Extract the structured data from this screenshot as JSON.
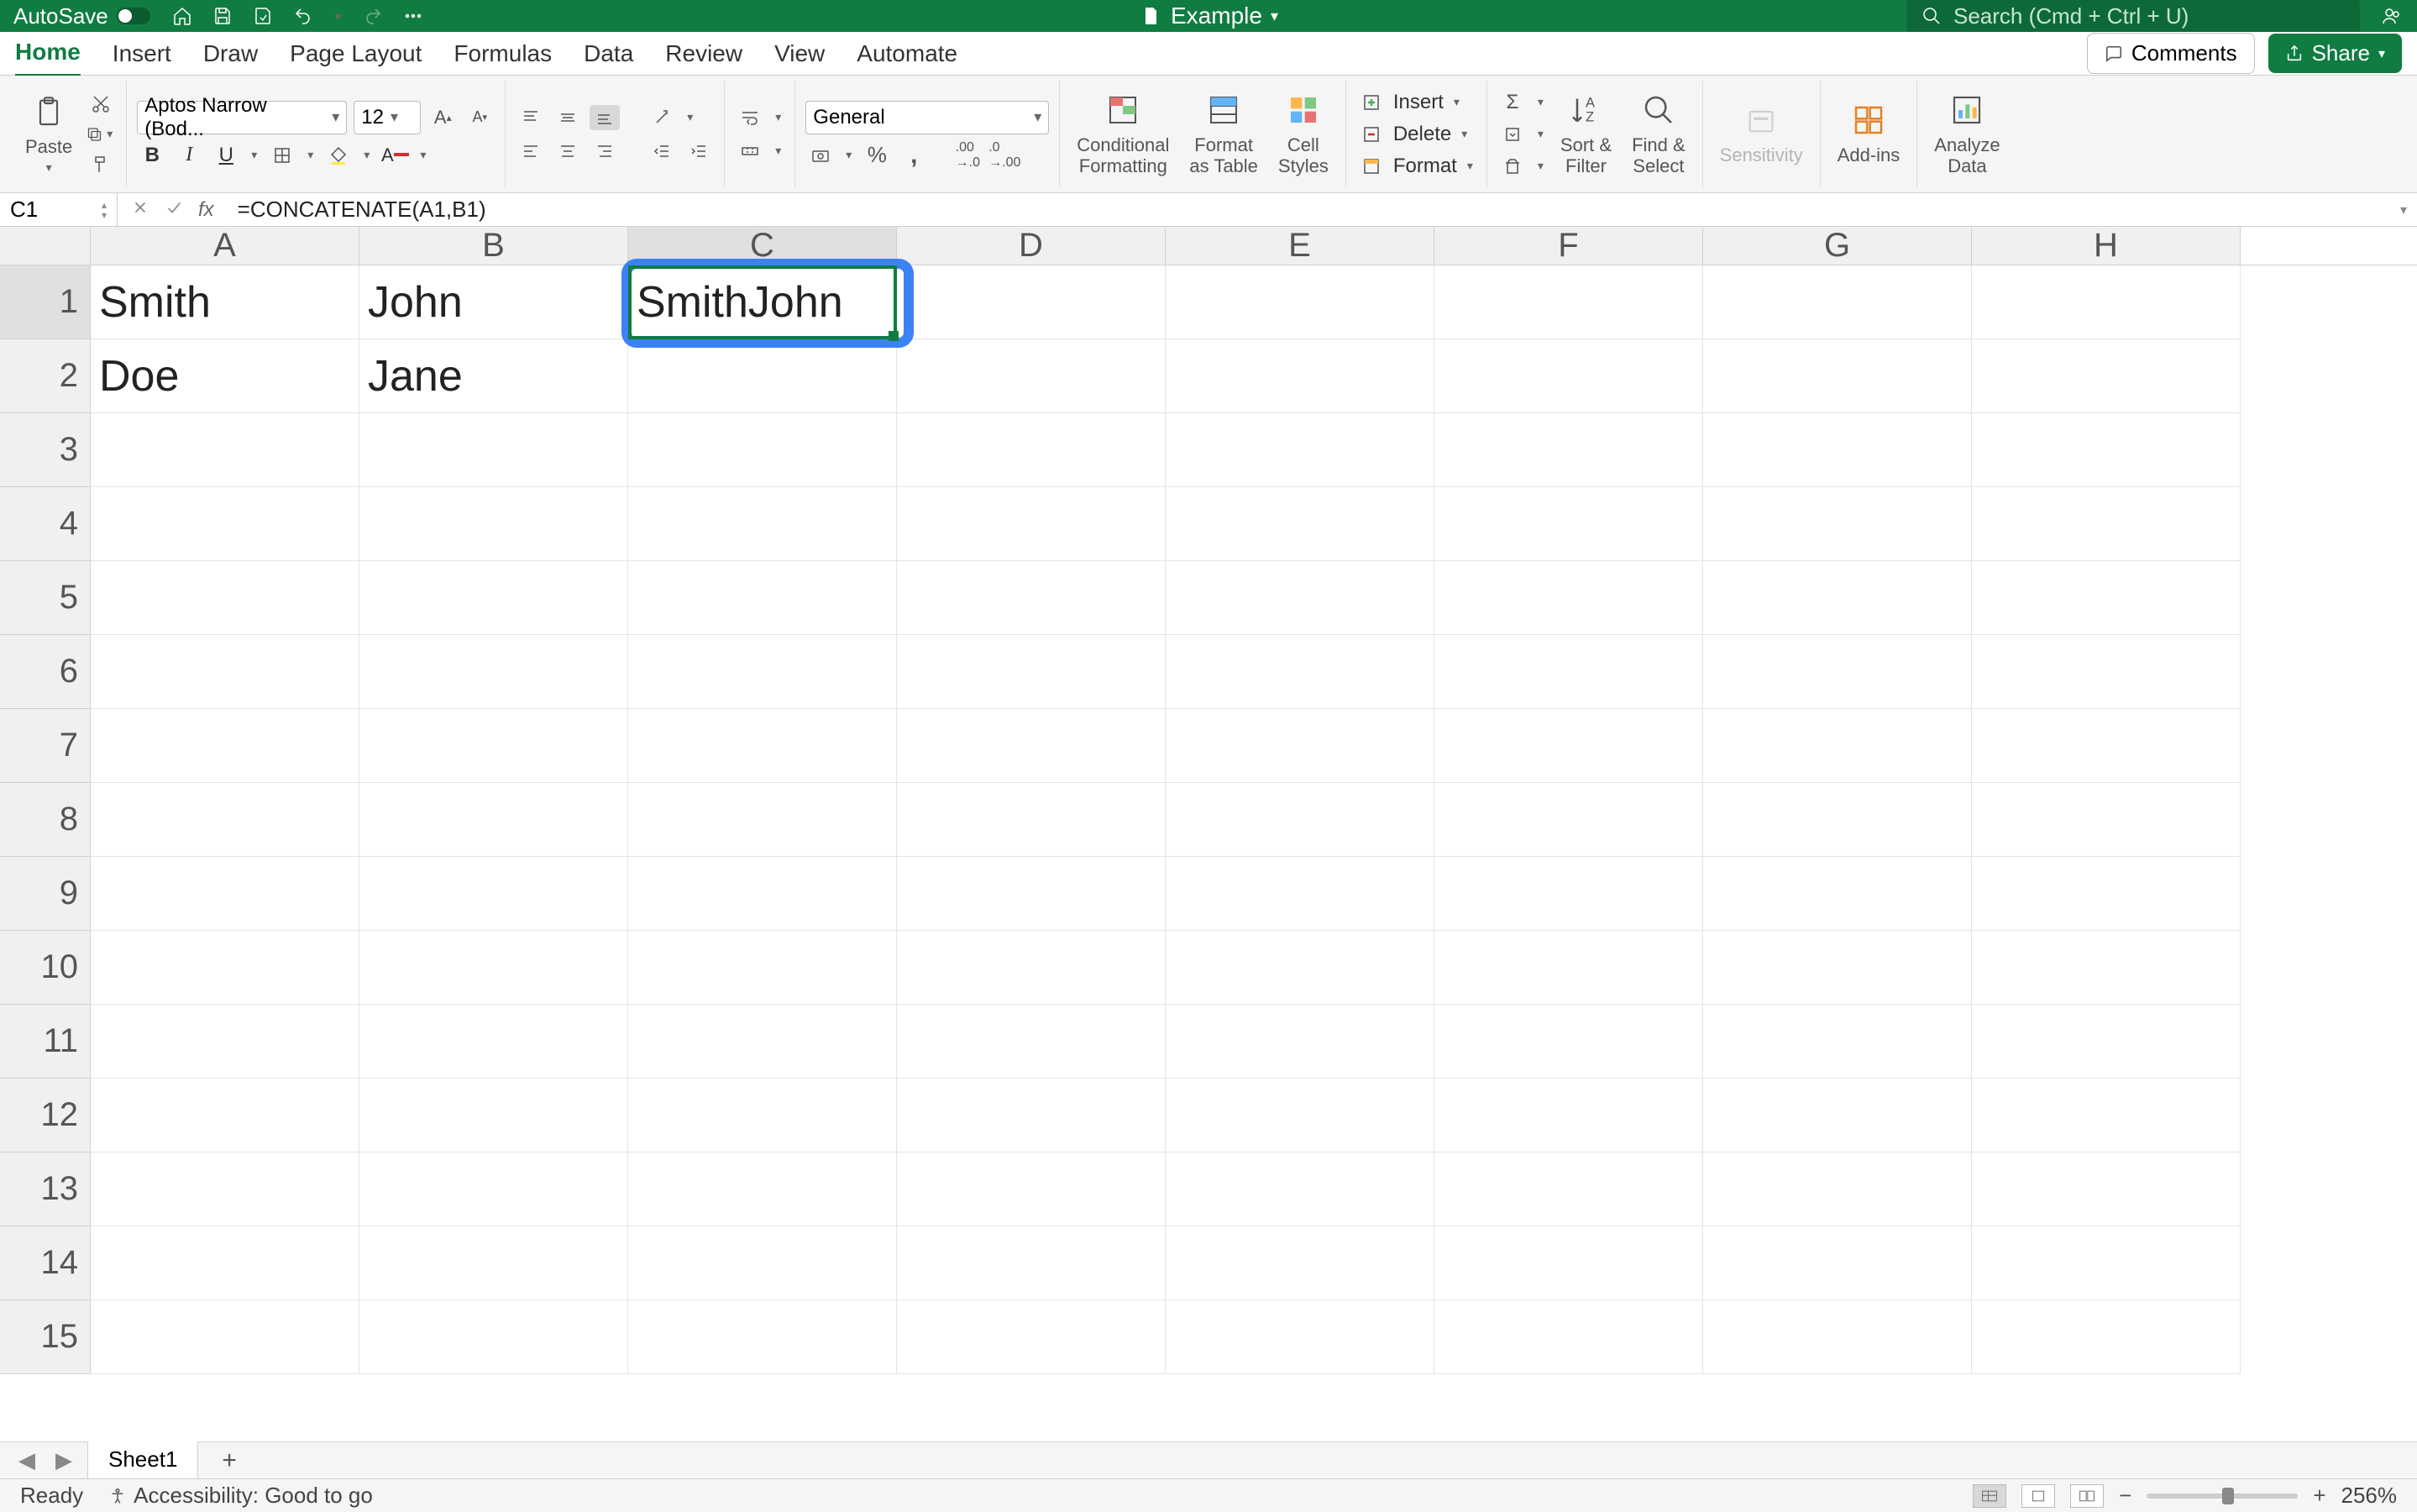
{
  "titleBar": {
    "autosave": "AutoSave",
    "docName": "Example",
    "searchPlaceholder": "Search (Cmd + Ctrl + U)"
  },
  "ribbonTabs": [
    "Home",
    "Insert",
    "Draw",
    "Page Layout",
    "Formulas",
    "Data",
    "Review",
    "View",
    "Automate"
  ],
  "ribbonActions": {
    "comments": "Comments",
    "share": "Share"
  },
  "ribbon": {
    "paste": "Paste",
    "fontName": "Aptos Narrow (Bod...",
    "fontSize": "12",
    "numberFormat": "General",
    "conditional": "Conditional\nFormatting",
    "formatTable": "Format\nas Table",
    "cellStyles": "Cell\nStyles",
    "insert": "Insert",
    "delete": "Delete",
    "format": "Format",
    "sortFilter": "Sort &\nFilter",
    "findSelect": "Find &\nSelect",
    "sensitivity": "Sensitivity",
    "addins": "Add-ins",
    "analyze": "Analyze\nData"
  },
  "formulaBar": {
    "nameBox": "C1",
    "formula": "=CONCATENATE(A1,B1)"
  },
  "grid": {
    "columns": [
      "A",
      "B",
      "C",
      "D",
      "E",
      "F",
      "G",
      "H"
    ],
    "rows": [
      "1",
      "2",
      "3",
      "4",
      "5",
      "6",
      "7",
      "8",
      "9",
      "10",
      "11",
      "12",
      "13",
      "14",
      "15"
    ],
    "data": {
      "A1": "Smith",
      "B1": "John",
      "C1": "SmithJohn",
      "A2": "Doe",
      "B2": "Jane"
    },
    "activeCell": "C1"
  },
  "sheetTabs": {
    "active": "Sheet1"
  },
  "statusBar": {
    "ready": "Ready",
    "accessibility": "Accessibility: Good to go",
    "zoom": "256%"
  }
}
